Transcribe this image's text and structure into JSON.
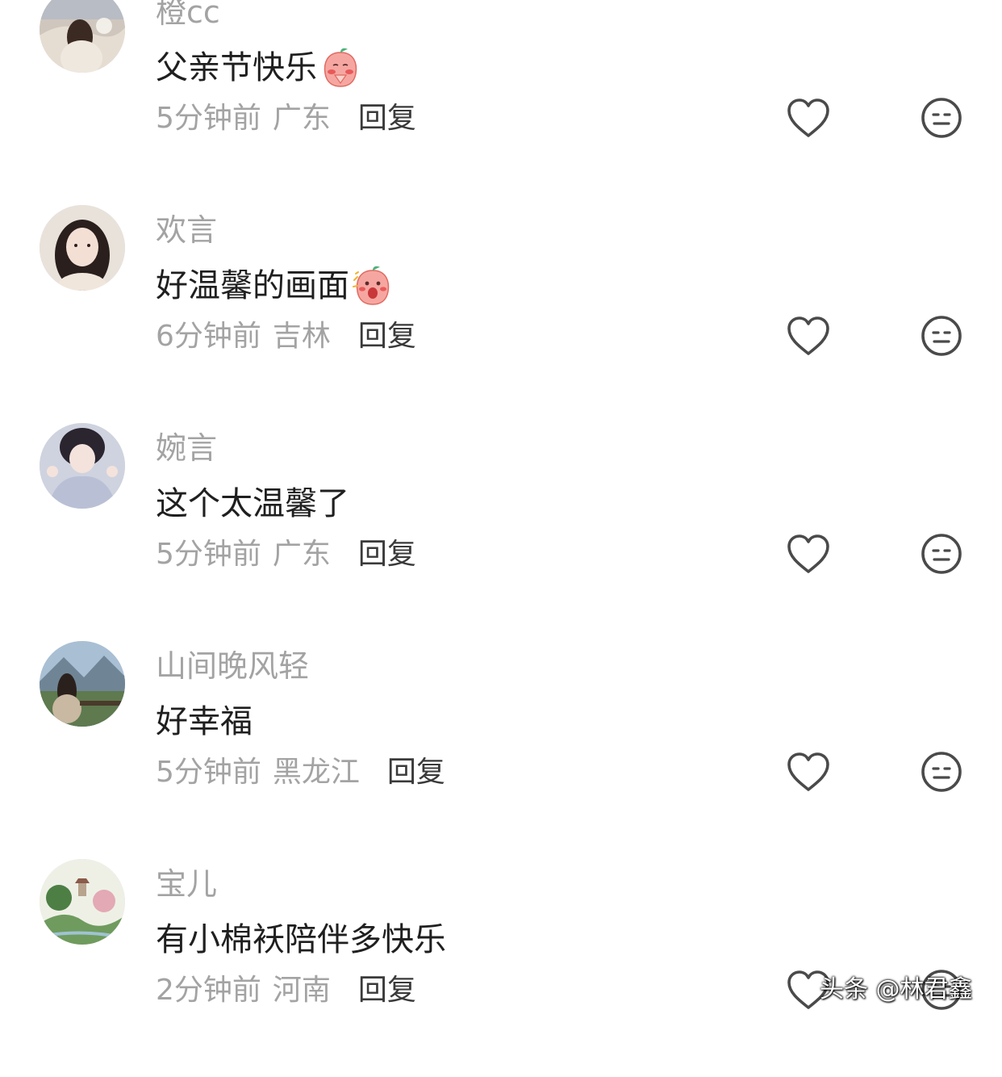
{
  "comments": [
    {
      "username": "橙cc",
      "text": "父亲节快乐",
      "emoji": "peach-praying-emoji",
      "time": "5分钟前",
      "region": "广东",
      "reply_label": "回复"
    },
    {
      "username": "欢言",
      "text": "好温馨的画面",
      "emoji": "peach-excited-emoji",
      "time": "6分钟前",
      "region": "吉林",
      "reply_label": "回复"
    },
    {
      "username": "婉言",
      "text": "这个太温馨了",
      "time": "5分钟前",
      "region": "广东",
      "reply_label": "回复"
    },
    {
      "username": "山间晚风轻",
      "text": "好幸福",
      "time": "5分钟前",
      "region": "黑龙江",
      "reply_label": "回复"
    },
    {
      "username": "宝儿",
      "text": "有小棉袄陪伴多快乐",
      "time": "2分钟前",
      "region": "河南",
      "reply_label": "回复"
    }
  ],
  "icons": {
    "like": "heart-outline-icon",
    "dislike": "meh-face-icon"
  },
  "colors": {
    "username": "#a3a3a3",
    "content": "#1f1f1f",
    "meta": "#a3a3a3",
    "reply": "#3a3a3a",
    "icon_stroke": "#4a4a4a"
  },
  "watermark": "头条 @林君鑫"
}
